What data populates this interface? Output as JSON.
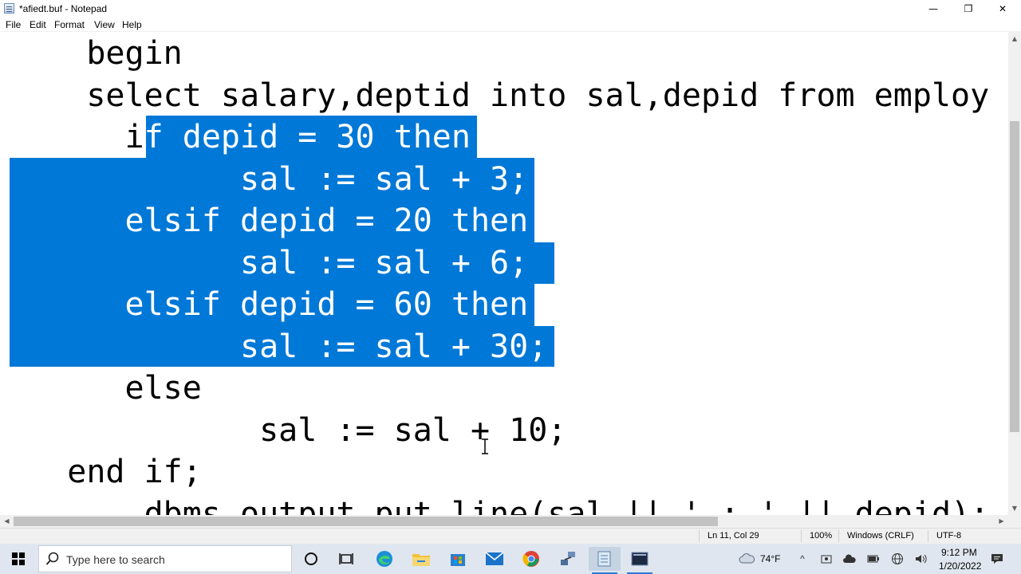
{
  "window": {
    "title": "*afiedt.buf - Notepad",
    "minimize_glyph": "—",
    "maximize_glyph": "❐",
    "close_glyph": "✕"
  },
  "menu": {
    "file": "File",
    "edit": "Edit",
    "format": "Format",
    "view": "View",
    "help": "Help"
  },
  "editor": {
    "lines": [
      "    begin",
      "    select salary,deptid into sal,depid from employ",
      "      if depid = 30 then",
      "            sal := sal + 3;",
      "      elsif depid = 20 then",
      "            sal := sal + 6;",
      "      elsif depid = 60 then",
      "            sal := sal + 30;",
      "      else",
      "             sal := sal + 10;",
      "   end if;",
      "       dbms_output.put_line(sal || ' : ' || depid);"
    ],
    "selected_text": "f depid = 30 then\n            sal := sal + 3;\n      elsif depid = 20 then\n            sal := sal + 6;\n      elsif depid = 60 then\n            sal := sal + 30;",
    "selection_color": "#0078d7"
  },
  "status": {
    "position": "Ln 11, Col 29",
    "zoom": "100%",
    "line_ending": "Windows (CRLF)",
    "encoding": "UTF-8"
  },
  "taskbar": {
    "search_placeholder": "Type here to search",
    "apps": [
      "cortana-icon",
      "task-view-icon",
      "edge-icon",
      "file-explorer-icon",
      "store-icon",
      "mail-icon",
      "chrome-icon",
      "network-tool-icon",
      "notepad-icon",
      "terminal-icon"
    ],
    "weather_temp": "74°F",
    "time": "9:12 PM",
    "date": "1/20/2022"
  },
  "colors": {
    "accent": "#0078d7",
    "taskbar_bg": "#dfe6ef"
  }
}
